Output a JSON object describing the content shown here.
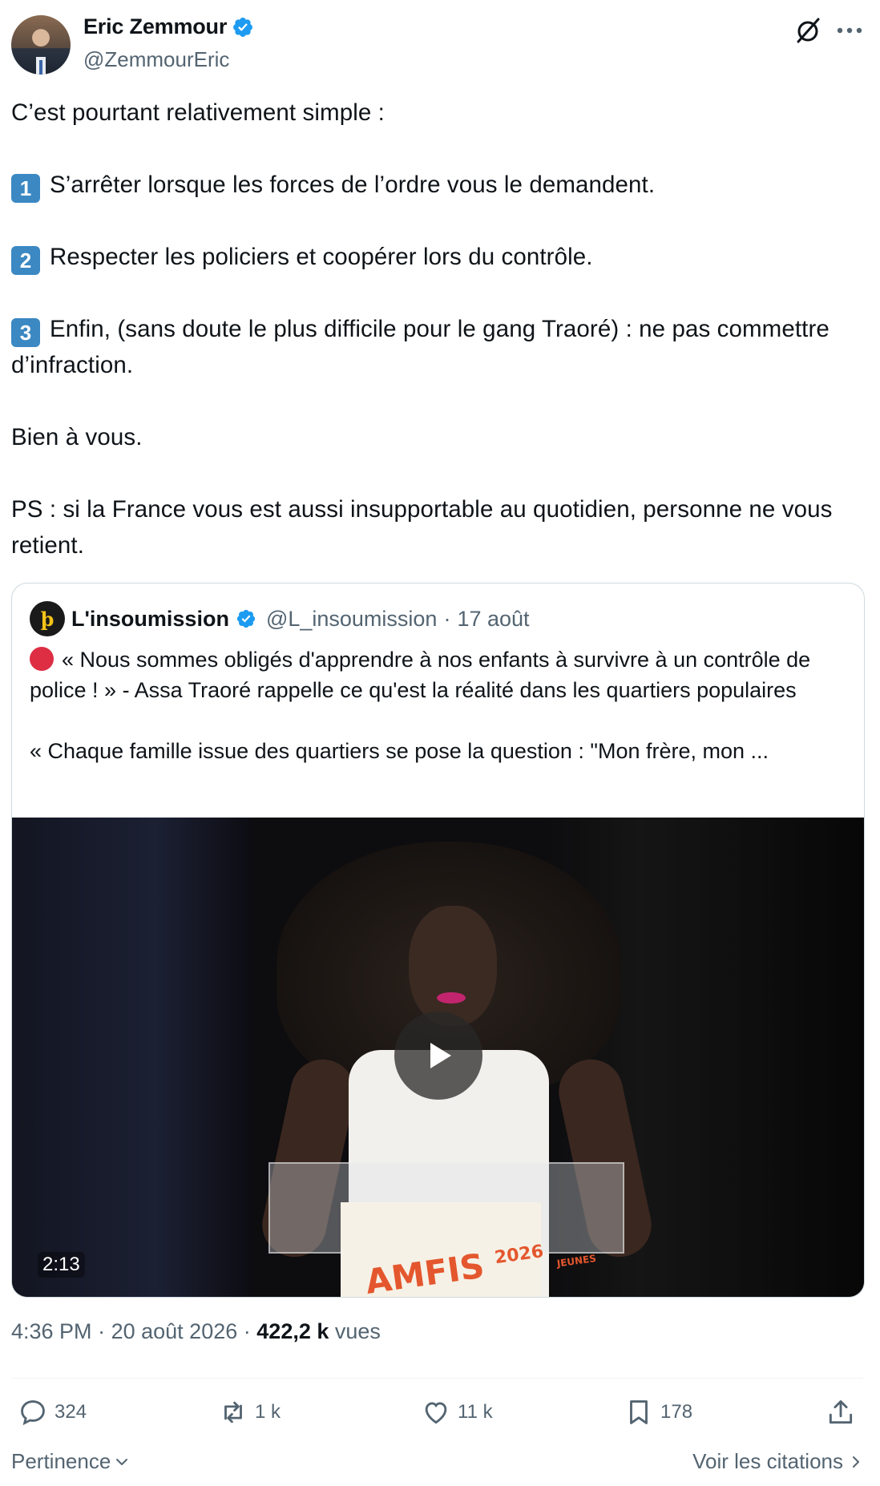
{
  "author": {
    "name": "Eric Zemmour",
    "handle": "@ZemmourEric",
    "verified": true
  },
  "icons": {
    "verified": "verified-badge-icon",
    "grok": "grok-icon",
    "more": "more-icon",
    "reply": "reply-icon",
    "retweet": "retweet-icon",
    "like": "heart-icon",
    "bookmark": "bookmark-icon",
    "share": "share-icon",
    "play": "play-icon"
  },
  "tweet": {
    "line1": "C’est pourtant relativement simple :",
    "item1_key": "1",
    "item1": "S’arrêter lorsque les forces de l’ordre vous le demandent.",
    "item2_key": "2",
    "item2": "Respecter les policiers et coopérer lors du contrôle.",
    "item3_key": "3",
    "item3": "Enfin, (sans doute le plus difficile pour le gang Traoré) : ne pas commettre d’infraction.",
    "closing": "Bien à vous.",
    "ps": "PS : si la France vous est aussi insupportable au quotidien, personne ne vous retient."
  },
  "quote": {
    "name": "L'insoumission",
    "handle": "@L_insoumission",
    "separator": "·",
    "date": "17 août",
    "text1": "« Nous sommes obligés d'apprendre à nos enfants à survivre à un contrôle de police ! » - Assa Traoré rappelle ce qu'est la réalité dans les quartiers populaires",
    "text2": "« Chaque famille issue des quartiers se pose la question : \"Mon frère, mon ...",
    "video_duration": "2:13",
    "sign_text": "AMFIS",
    "sign_year": "2026",
    "sign_sub": "JEUNES"
  },
  "meta": {
    "time": "4:36 PM",
    "separator": "·",
    "date": "20 août 2026",
    "views_count": "422,2 k",
    "views_label": "vues"
  },
  "actions": {
    "replies": "324",
    "retweets": "1 k",
    "likes": "11 k",
    "bookmarks": "178"
  },
  "footer": {
    "sort_label": "Pertinence",
    "quotes_link": "Voir les citations"
  },
  "colors": {
    "text": "#0f1419",
    "secondary": "#536471",
    "verified": "#1d9bf0",
    "keycap": "#3b88c3",
    "red_dot": "#dd2e44"
  }
}
